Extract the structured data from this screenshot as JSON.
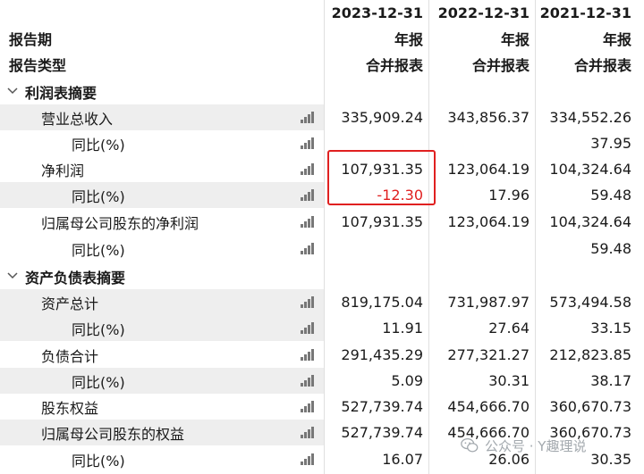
{
  "header": {
    "periods": [
      "2023-12-31",
      "2022-12-31",
      "2021-12-31"
    ],
    "row_report_period": "报告期",
    "row_report_type": "报告类型",
    "report_period_values": [
      "年报",
      "年报",
      "年报"
    ],
    "report_type_values": [
      "合并报表",
      "合并报表",
      "合并报表"
    ]
  },
  "sections": {
    "income": "利润表摘要",
    "balance": "资产负债表摘要"
  },
  "rows": [
    {
      "label": "营业总收入",
      "values": [
        "335,909.24",
        "343,856.37",
        "334,552.26"
      ]
    },
    {
      "label": "同比(%)",
      "values": [
        "",
        "",
        "37.95"
      ]
    },
    {
      "label": "净利润",
      "values": [
        "107,931.35",
        "123,064.19",
        "104,324.64"
      ]
    },
    {
      "label": "同比(%)",
      "values": [
        "-12.30",
        "17.96",
        "59.48"
      ]
    },
    {
      "label": "归属母公司股东的净利润",
      "values": [
        "107,931.35",
        "123,064.19",
        "104,324.64"
      ]
    },
    {
      "label": "同比(%)",
      "values": [
        "",
        "",
        "59.48"
      ]
    },
    {
      "label": "资产总计",
      "values": [
        "819,175.04",
        "731,987.97",
        "573,494.58"
      ]
    },
    {
      "label": "同比(%)",
      "values": [
        "11.91",
        "27.64",
        "33.15"
      ]
    },
    {
      "label": "负债合计",
      "values": [
        "291,435.29",
        "277,321.27",
        "212,823.85"
      ]
    },
    {
      "label": "同比(%)",
      "values": [
        "5.09",
        "30.31",
        "38.17"
      ]
    },
    {
      "label": "股东权益",
      "values": [
        "527,739.74",
        "454,666.70",
        "360,670.73"
      ]
    },
    {
      "label": "归属母公司股东的权益",
      "values": [
        "527,739.74",
        "454,666.70",
        "360,670.73"
      ]
    },
    {
      "label": "同比(%)",
      "values": [
        "16.07",
        "26.06",
        "30.35"
      ]
    }
  ],
  "watermark": "公众号 · Y趣理说",
  "colors": {
    "highlight_border": "#e02020",
    "negative": "#e02020",
    "row_shade": "#eeeeee"
  },
  "icons": {
    "row_chart": "bar-chart-icon",
    "section_toggle": "chevron-down-icon",
    "watermark": "wechat-icon"
  }
}
